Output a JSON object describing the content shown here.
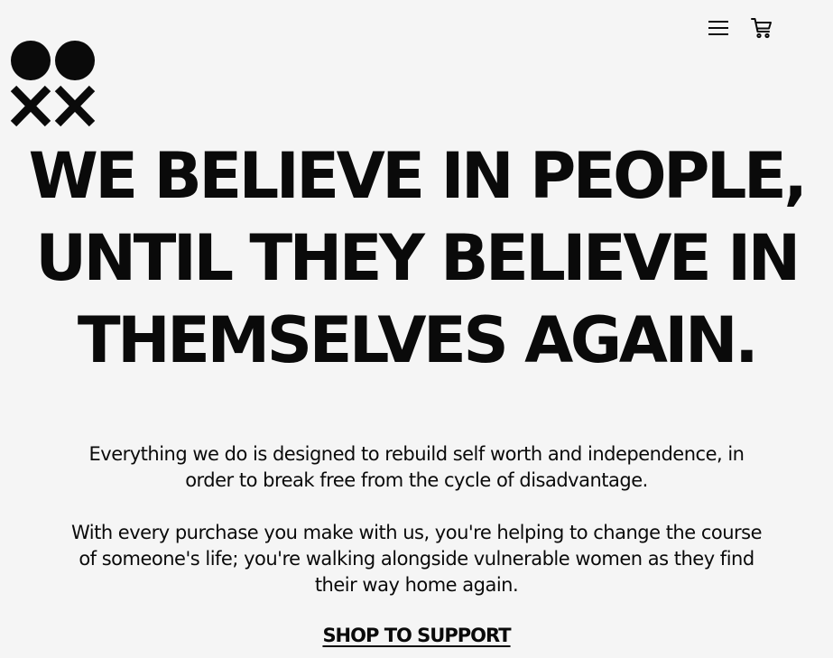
{
  "header": {
    "icons": [
      "hamburger-menu-icon",
      "shopping-cart-icon"
    ]
  },
  "logo": {
    "icon": "two-dots-two-crosses-logo"
  },
  "hero": {
    "headline_lines": [
      "WE BELIEVE IN PEOPLE,",
      "UNTIL THEY BELIEVE IN",
      "THEMSELVES AGAIN."
    ]
  },
  "body": {
    "paragraph1_lines": [
      "Everything we do is designed to rebuild self worth and independence, in",
      "order to break free from the cycle of disadvantage."
    ],
    "paragraph2_lines": [
      "With every purchase you make with us, you're helping to change the course",
      "of someone's life; you're walking alongside vulnerable women as they find",
      "their way home again."
    ]
  },
  "cta": {
    "label": "SHOP TO SUPPORT"
  },
  "colors": {
    "background": "#f5f5f5",
    "text": "#0a0a0a"
  }
}
